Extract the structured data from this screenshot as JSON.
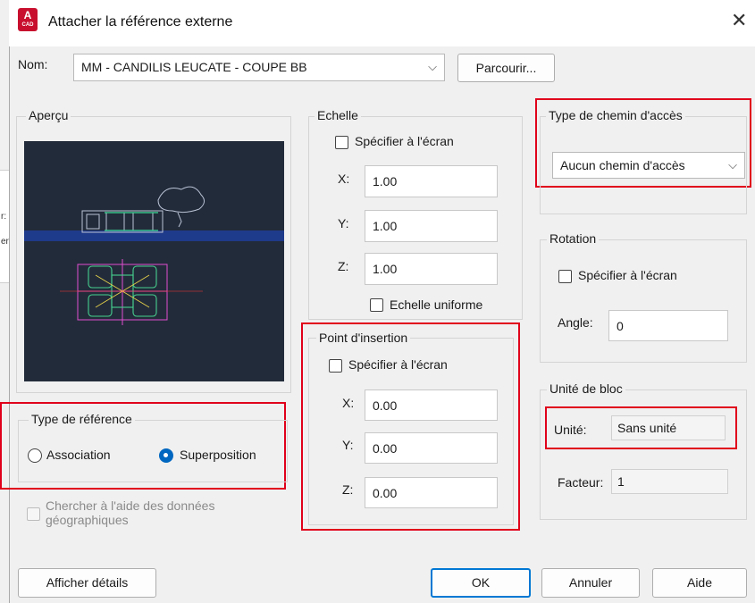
{
  "window": {
    "title": "Attacher la référence externe",
    "app_icon_text": "A",
    "app_icon_sub": "CAD"
  },
  "background": {
    "label_1": "r:",
    "label_2": "er:"
  },
  "name": {
    "label": "Nom:",
    "value": "MM - CANDILIS LEUCATE - COUPE BB",
    "browse": "Parcourir..."
  },
  "preview": {
    "legend": "Aperçu"
  },
  "ref_type": {
    "legend": "Type de référence",
    "option_1": "Association",
    "option_2": "Superposition",
    "selected": "Superposition"
  },
  "geo": {
    "label": "Chercher à l'aide des données géographiques"
  },
  "scale": {
    "legend": "Echelle",
    "on_screen": "Spécifier à l'écran",
    "x_label": "X:",
    "x": "1.00",
    "y_label": "Y:",
    "y": "1.00",
    "z_label": "Z:",
    "z": "1.00",
    "uniform": "Echelle uniforme"
  },
  "insertion": {
    "legend": "Point d'insertion",
    "on_screen": "Spécifier à l'écran",
    "x_label": "X:",
    "x": "0.00",
    "y_label": "Y:",
    "y": "0.00",
    "z_label": "Z:",
    "z": "0.00"
  },
  "path_type": {
    "legend": "Type de chemin d'accès",
    "value": "Aucun chemin d'accès"
  },
  "rotation": {
    "legend": "Rotation",
    "on_screen": "Spécifier à l'écran",
    "angle_label": "Angle:",
    "angle": "0"
  },
  "block_unit": {
    "legend": "Unité de bloc",
    "unit_label": "Unité:",
    "unit": "Sans unité",
    "factor_label": "Facteur:",
    "factor": "1"
  },
  "buttons": {
    "details": "Afficher détails",
    "ok": "OK",
    "cancel": "Annuler",
    "help": "Aide"
  },
  "colors": {
    "highlight": "#e0001b",
    "accent": "#0067c0",
    "preview_bg": "#222b3a"
  }
}
